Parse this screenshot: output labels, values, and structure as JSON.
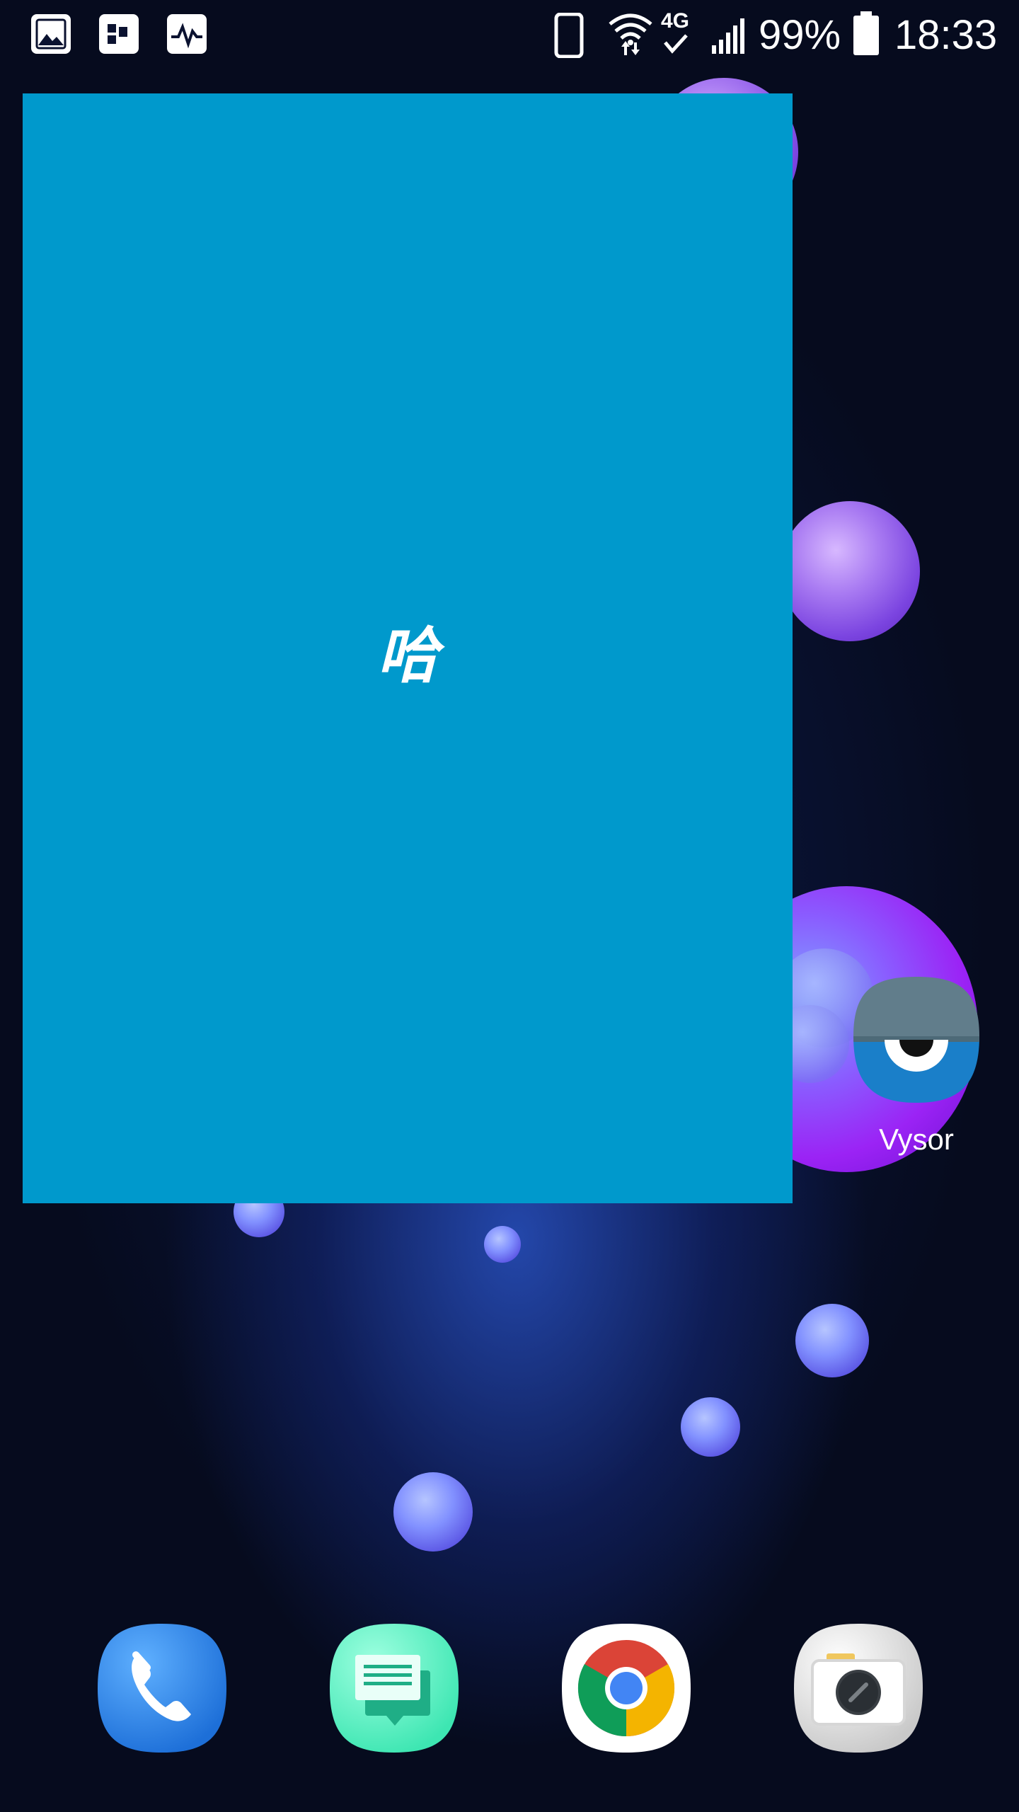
{
  "status_bar": {
    "notification_icons": [
      "image-icon",
      "usb-transfer-icon",
      "activity-monitor-icon"
    ],
    "system_icons": [
      "phone-icon",
      "wifi-icon",
      "4g-icon",
      "signal-icon"
    ],
    "network_label": "4G",
    "battery_percent": "99%",
    "time": "18:33"
  },
  "overlay": {
    "text": "哈",
    "color": "#0099cc"
  },
  "home_apps": [
    {
      "label": "Vysor",
      "icon": "vysor-icon"
    }
  ],
  "dock": {
    "apps": [
      {
        "icon": "phone-icon"
      },
      {
        "icon": "messages-icon"
      },
      {
        "icon": "chrome-icon"
      },
      {
        "icon": "camera-icon"
      }
    ]
  }
}
